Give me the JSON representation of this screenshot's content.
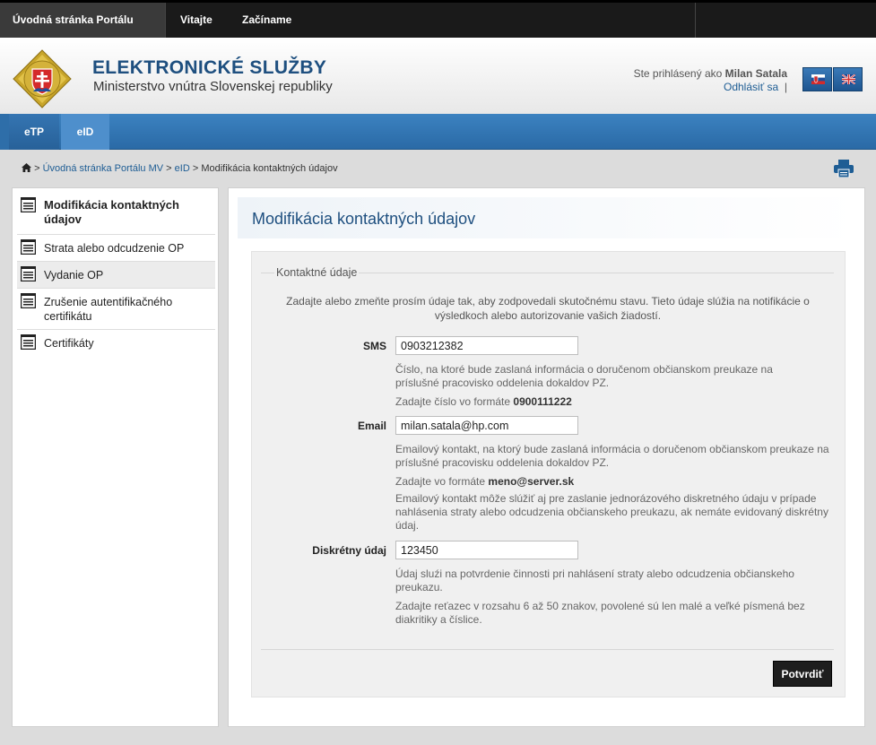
{
  "topnav": {
    "items": [
      "Úvodná stránka Portálu MV",
      "Vitajte",
      "Začíname"
    ]
  },
  "header": {
    "title": "ELEKTRONICKÉ SLUŽBY",
    "subtitle": "Ministerstvo vnútra Slovenskej republiky",
    "logged_in_prefix": "Ste prihlásený ako",
    "user_name": "Milan Satala",
    "logout": "Odhlásiť sa",
    "logout_sep": "|",
    "languages": [
      "sk-flag-icon",
      "uk-flag-icon"
    ]
  },
  "mainnav": {
    "tabs": [
      "eTP",
      "eID"
    ],
    "active": "eID"
  },
  "breadcrumb": {
    "sep": ">",
    "home_link": "Úvodná stránka Portálu MV",
    "eid_link": "eID",
    "current": "Modifikácia kontaktných údajov"
  },
  "sidebar": {
    "items": [
      {
        "label": "Modifikácia kontaktných údajov",
        "active": true
      },
      {
        "label": "Strata alebo odcudzenie OP"
      },
      {
        "label": "Vydanie OP"
      },
      {
        "label": "Zrušenie autentifikačného certifikátu"
      },
      {
        "label": "Certifikáty"
      }
    ]
  },
  "main": {
    "title": "Modifikácia kontaktných údajov",
    "fieldset_legend": "Kontaktné údaje",
    "intro": "Zadajte alebo zmeňte prosím údaje tak, aby zodpovedali skutočnému stavu. Tieto údaje slúžia na notifikácie o výsledkoch alebo autorizovanie vašich žiadostí.",
    "sms": {
      "label": "SMS",
      "value": "0903212382",
      "help1": "Číslo, na ktoré bude zaslaná informácia o doručenom občianskom preukaze na príslušné pracovisko oddelenia dokaldov PZ.",
      "help2_prefix": "Zadajte číslo vo formáte",
      "help2_format": "0900111222"
    },
    "email": {
      "label": "Email",
      "value": "milan.satala@hp.com",
      "help1": "Emailový kontakt, na ktorý bude zaslaná informácia o doručenom občianskom preukaze na príslušné pracovisku oddelenia dokaldov PZ.",
      "help2_prefix": "Zadajte vo formáte",
      "help2_format": "meno@server.sk",
      "help3": "Emailový kontakt môže slúžiť aj pre zaslanie jednorázového diskretného údaju v prípade nahlásenia straty alebo odcudzenia občianskeho preukazu, ak nemáte evidovaný diskrétny údaj."
    },
    "discreet": {
      "label": "Diskrétny údaj",
      "value": "123450",
      "help1": "Údaj sluźi na potvrdenie činnosti pri nahlásení straty alebo odcudzenia občianskeho preukazu.",
      "help2": "Zadajte reťazec v rozsahu 6 až 50 znakov, povolené sú len malé a veľké písmená bez diakritiky a číslice."
    },
    "submit_label": "Potvrdiť"
  },
  "colors": {
    "brand_blue": "#1e4f7f",
    "nav_blue": "#3c82c0",
    "topbar": "#1a1a1a"
  }
}
